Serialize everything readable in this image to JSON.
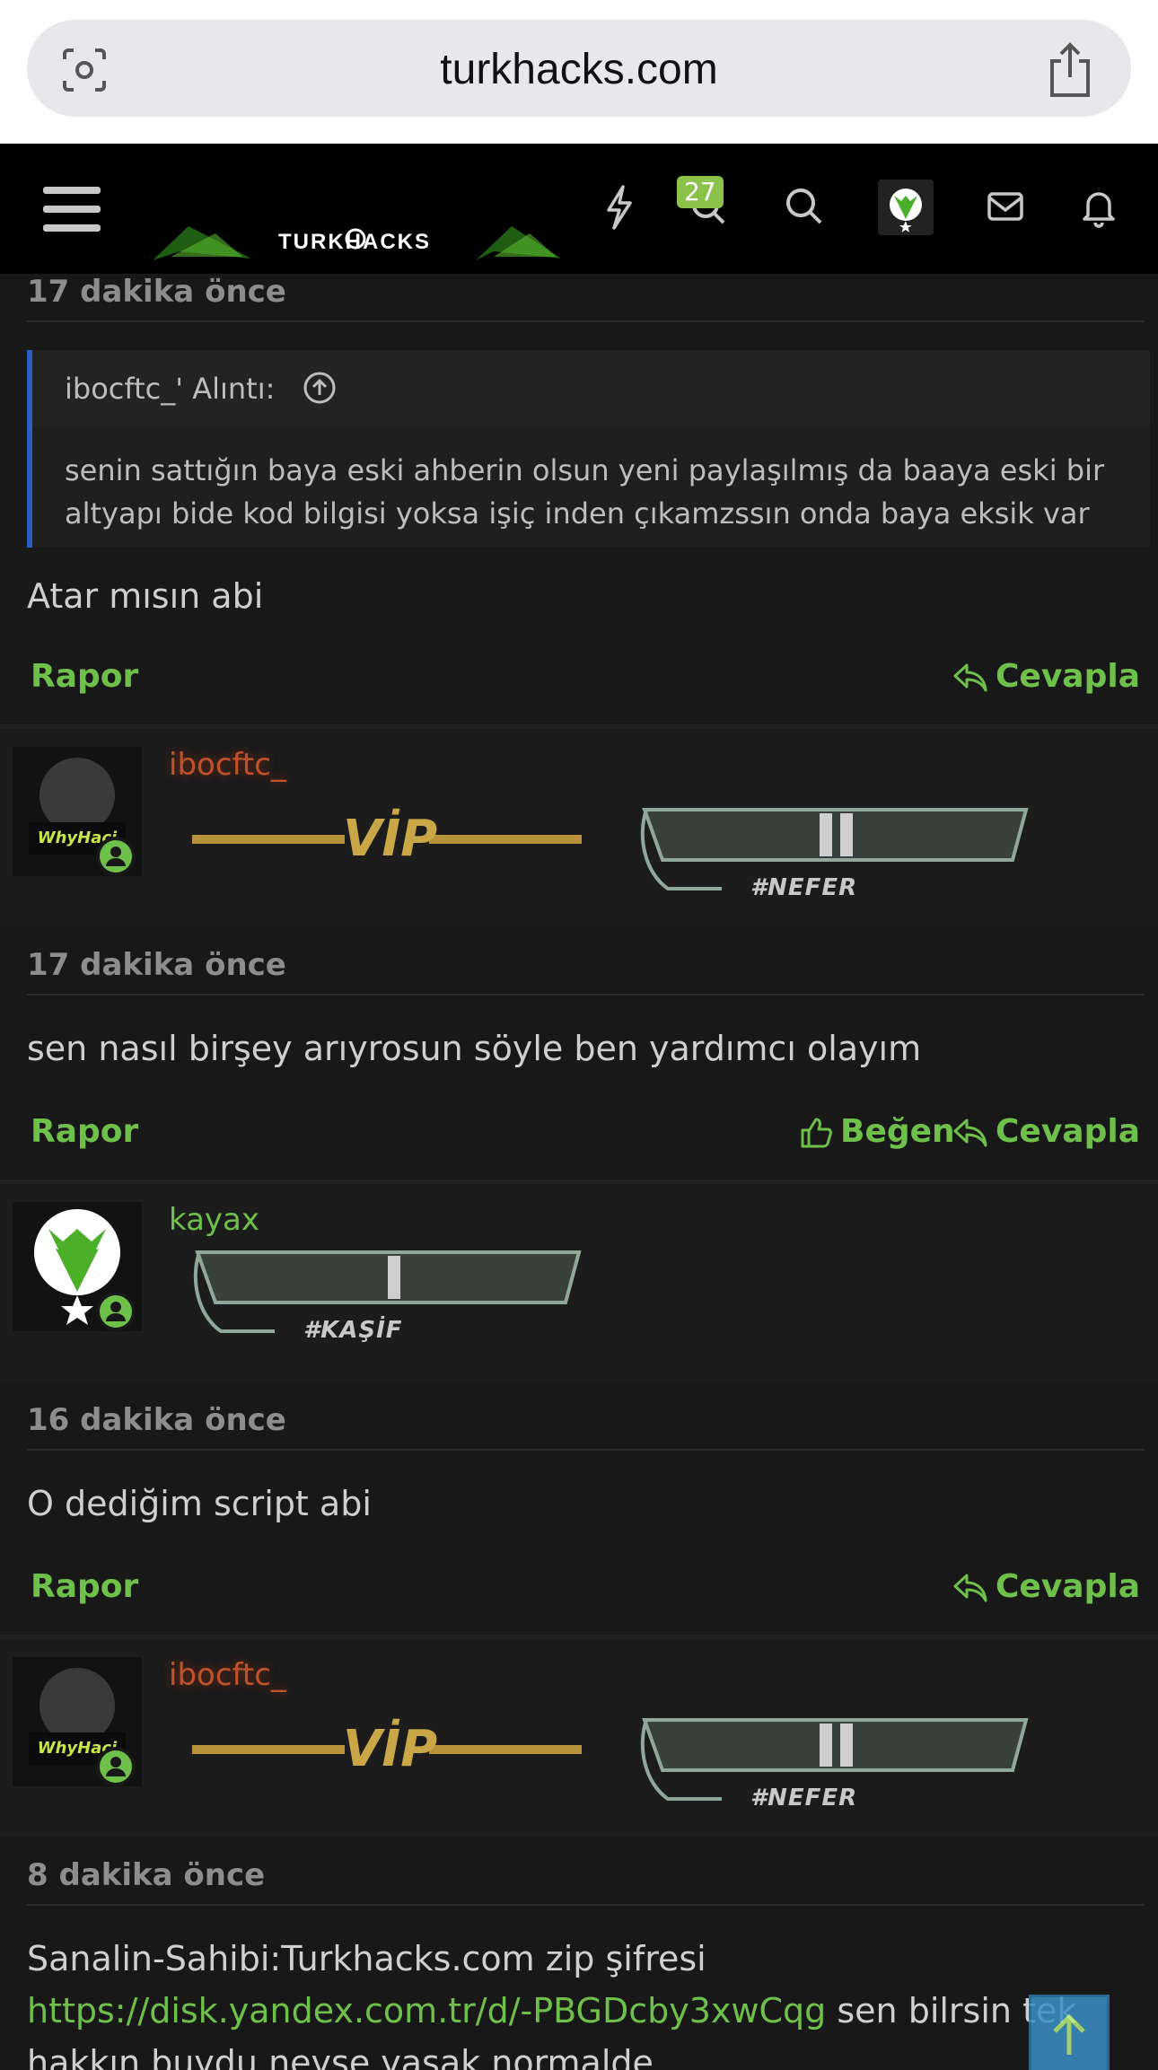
{
  "browser": {
    "url": "turkhacks.com"
  },
  "nav": {
    "brand": "TURKHACKS",
    "badge_count": "27"
  },
  "posts": [
    {
      "time": "17 dakika önce",
      "quote_title": "ibocftc_' Alıntı:",
      "quote_body": "senin sattığın baya eski ahberin olsun yeni paylaşılmış da baaya eski bir altyapı bide kod bilgisi yoksa işiç inden çıkamzssın onda baya eksik var",
      "message": "Atar mısın abi",
      "report": "Rapor",
      "reply": "Cevapla"
    },
    {
      "user": "ibocftc_",
      "avatar_tag": "WhyHaci",
      "vip": "VİP",
      "rank": "#NEFER",
      "time": "17 dakika önce",
      "message": "sen nasıl birşey arıyrosun söyle ben yardımcı olayım",
      "report": "Rapor",
      "like": "Beğen",
      "reply": "Cevapla"
    },
    {
      "user": "kayax",
      "rank": "#KAŞİF",
      "time": "16 dakika önce",
      "message": "O dediğim script abi",
      "report": "Rapor",
      "reply": "Cevapla"
    },
    {
      "user": "ibocftc_",
      "avatar_tag": "WhyHaci",
      "vip": "VİP",
      "rank": "#NEFER",
      "time": "8 dakika önce",
      "message_line1": "Sanalin-Sahibi:Turkhacks.com zip şifresi",
      "message_link": "https://disk.yandex.com.tr/d/-PBGDcby3xwCqg",
      "message_after_link": " sen bilrsin tek",
      "message_line3": "hakkın buydu neyse yasak normalde"
    }
  ],
  "colors": {
    "accent": "#6fc04a",
    "vip_user": "#c0522b",
    "quote_border": "#2b5fc4"
  }
}
